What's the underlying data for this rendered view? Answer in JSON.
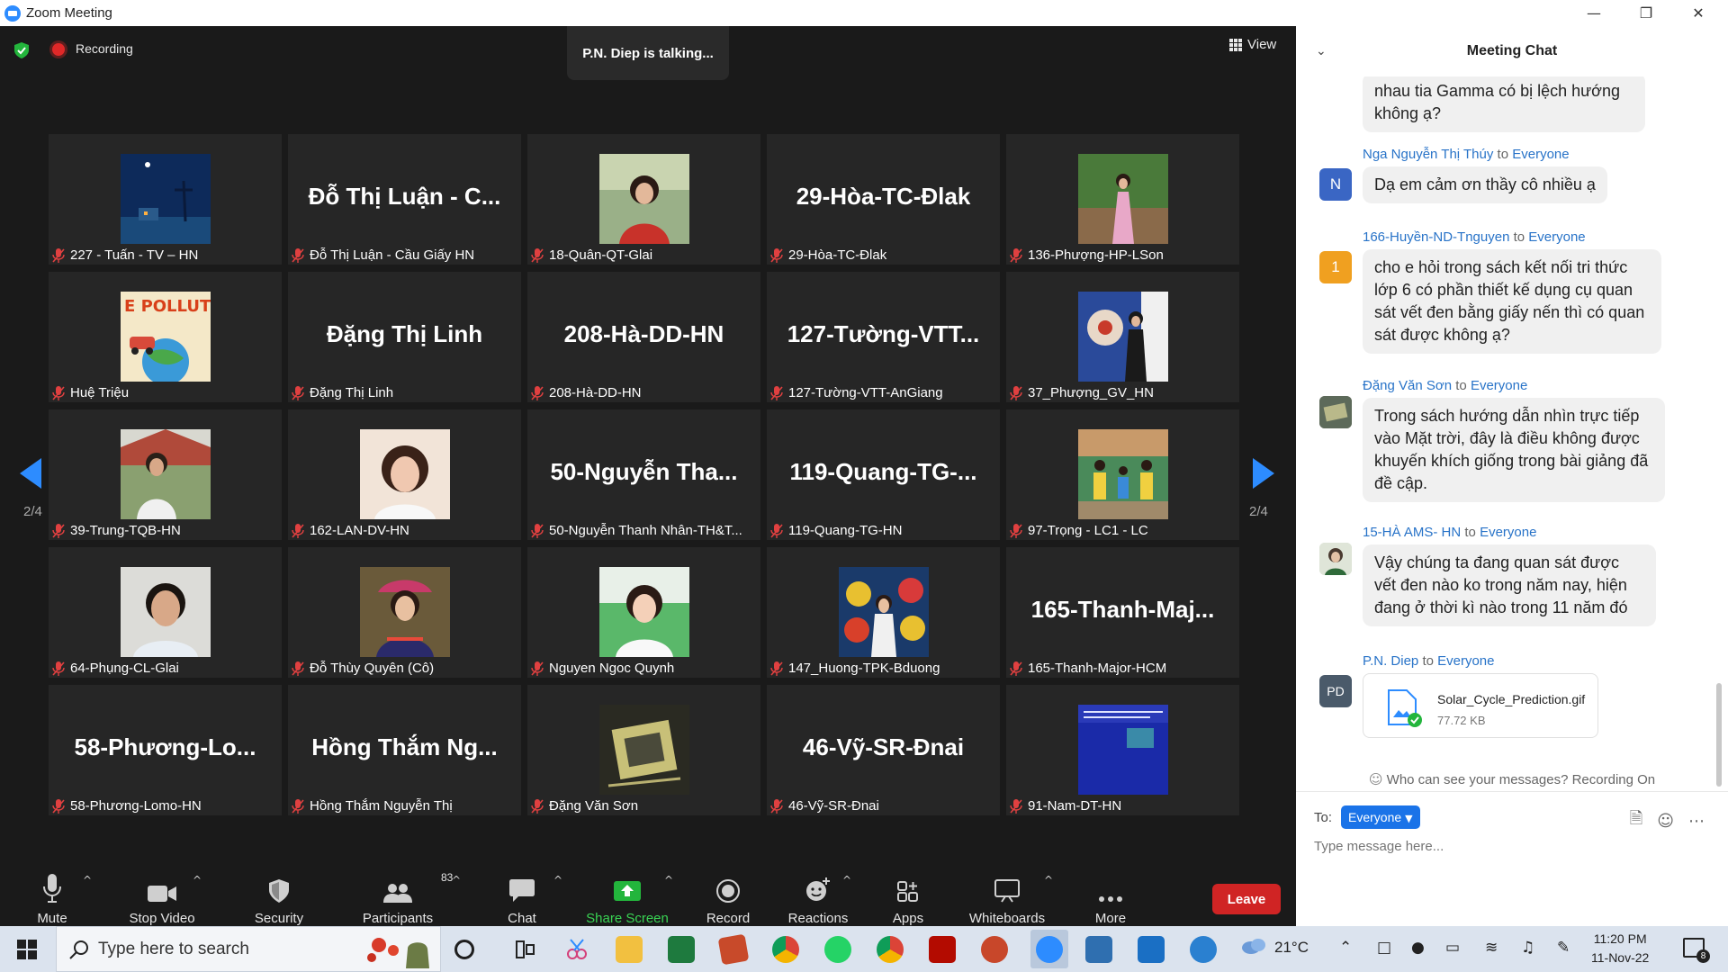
{
  "window": {
    "title": "Zoom Meeting",
    "controls": [
      "—",
      "❐",
      "✕"
    ]
  },
  "status": {
    "recording": "Recording",
    "talking": "P.N. Diep is talking...",
    "view": "View"
  },
  "pagination": {
    "left": "2/4",
    "right": "2/4"
  },
  "tiles": [
    {
      "name": "227 - Tuấn - TV – HN",
      "big": "",
      "photo": "night"
    },
    {
      "name": "Đỗ Thị Luận - Cầu Giấy HN",
      "big": "Đỗ Thị Luận - C...",
      "photo": ""
    },
    {
      "name": "18-Quân-QT-Glai",
      "big": "",
      "photo": "woman-red"
    },
    {
      "name": "29-Hòa-TC-Đlak",
      "big": "29-Hòa-TC-Đlak",
      "photo": ""
    },
    {
      "name": "136-Phượng-HP-LSon",
      "big": "",
      "photo": "woman-pink"
    },
    {
      "name": "Huệ Triệu",
      "big": "",
      "photo": "pollution"
    },
    {
      "name": "Đặng Thị Linh",
      "big": "Đặng Thị Linh",
      "photo": ""
    },
    {
      "name": "208-Hà-DD-HN",
      "big": "208-Hà-DD-HN",
      "photo": ""
    },
    {
      "name": "127-Tường-VTT-AnGiang",
      "big": "127-Tường-VTT...",
      "photo": ""
    },
    {
      "name": "37_Phượng_GV_HN",
      "big": "",
      "photo": "woman-flowers"
    },
    {
      "name": "39-Trung-TQB-HN",
      "big": "",
      "photo": "man-house"
    },
    {
      "name": "162-LAN-DV-HN",
      "big": "",
      "photo": "woman-white"
    },
    {
      "name": "50-Nguyễn Thanh Nhân-TH&T...",
      "big": "50-Nguyễn Tha...",
      "photo": ""
    },
    {
      "name": "119-Quang-TG-HN",
      "big": "119-Quang-TG-...",
      "photo": ""
    },
    {
      "name": "97-Trọng - LC1 - LC",
      "big": "",
      "photo": "family"
    },
    {
      "name": "64-Phụng-CL-Glai",
      "big": "",
      "photo": "man-smile"
    },
    {
      "name": "Đỗ Thùy Quyên (Cô)",
      "big": "",
      "photo": "woman-hmong"
    },
    {
      "name": "Nguyen Ngoc Quynh",
      "big": "",
      "photo": "woman-green"
    },
    {
      "name": "147_Huong-TPK-Bduong",
      "big": "",
      "photo": "woman-bouquet"
    },
    {
      "name": "165-Thanh-Major-HCM",
      "big": "165-Thanh-Maj...",
      "photo": ""
    },
    {
      "name": "58-Phương-Lomo-HN",
      "big": "58-Phương-Lo...",
      "photo": ""
    },
    {
      "name": "Hồng Thắm Nguyễn Thị",
      "big": "Hồng Thắm Ng...",
      "photo": ""
    },
    {
      "name": "Đặng Văn Sơn",
      "big": "",
      "photo": "chip"
    },
    {
      "name": "46-Vỹ-SR-Đnai",
      "big": "46-Vỹ-SR-Đnai",
      "photo": ""
    },
    {
      "name": "91-Nam-DT-HN",
      "big": "",
      "photo": "slide"
    }
  ],
  "toolbar": {
    "mute": "Mute",
    "stop_video": "Stop Video",
    "security": "Security",
    "participants": "Participants",
    "participants_count": "83",
    "chat": "Chat",
    "share_screen": "Share Screen",
    "record": "Record",
    "reactions": "Reactions",
    "apps": "Apps",
    "whiteboards": "Whiteboards",
    "more": "More",
    "leave": "Leave",
    "caret": "^"
  },
  "chat": {
    "title": "Meeting Chat",
    "collapse": "⌄",
    "messages": [
      {
        "sender": "",
        "to": "",
        "recipient": "",
        "text": "nhau tia Gamma có bị lệch hướng không ạ?"
      },
      {
        "sender": "Nga Nguyễn Thị Thúy",
        "to": "to",
        "recipient": "Everyone",
        "text": "Dạ em cảm ơn thầy cô nhiều ạ",
        "avatar": "N",
        "avatar_color": "#3a66c4"
      },
      {
        "sender": "166-Huyền-ND-Tnguyen",
        "to": "to",
        "recipient": "Everyone",
        "text": "cho e hỏi trong sách kết nối tri thức lớp 6 có phần thiết kế dụng cụ quan sát vết đen bằng giấy nến thì có quan sát được không ạ?",
        "avatar": "1",
        "avatar_color": "#f0a020"
      },
      {
        "sender": "Đặng Văn Sơn",
        "to": "to",
        "recipient": "Everyone",
        "text": "Trong sách hướng dẫn nhìn trực tiếp vào Mặt trời, đây là điều không được khuyến khích giống trong bài giảng đã đề cập."
      },
      {
        "sender": "15-HÀ AMS- HN",
        "to": "to",
        "recipient": "Everyone",
        "text": "Vậy chúng ta đang quan sát được vết đen nào ko trong năm nay, hiện đang ở thời kì nào trong 11 năm đó"
      },
      {
        "sender": "P.N. Diep",
        "to": "to",
        "recipient": "Everyone",
        "avatar": "PD",
        "avatar_color": "#4a5a6a",
        "file_name": "Solar_Cycle_Prediction.gif",
        "file_size": "77.72 KB"
      }
    ],
    "who_can_see": "Who can see your messages? Recording On",
    "to_label": "To:",
    "to_value": "Everyone",
    "input_placeholder": "Type message here..."
  },
  "taskbar": {
    "search_placeholder": "Type here to search",
    "weather": "21°C",
    "time": "11:20 PM",
    "date": "11-Nov-22",
    "notifications": "8"
  },
  "colors": {
    "accent": "#2D8CFF",
    "leave": "#d02424",
    "share": "#23b53c",
    "link": "#2873c8"
  }
}
